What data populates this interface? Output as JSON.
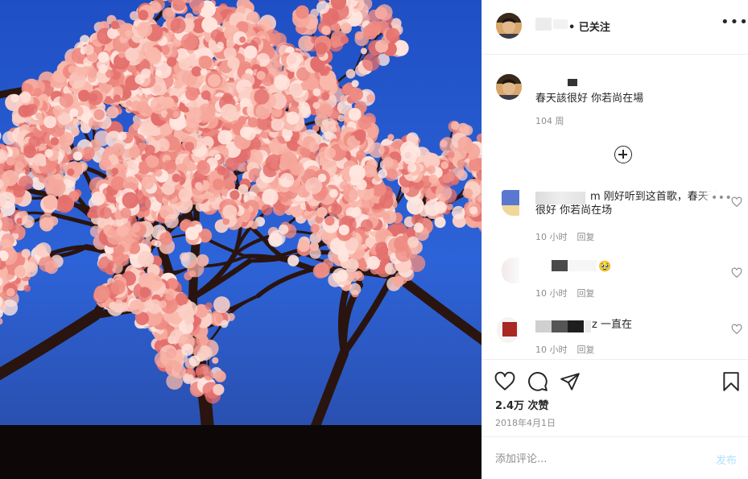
{
  "header": {
    "status_text": "• 已关注",
    "more_icon": "more-horizontal-icon"
  },
  "caption": {
    "text": "春天該很好 你若尚在場",
    "time": "104 周"
  },
  "load_more_icon": "add-circle-icon",
  "comments": [
    {
      "line1": "m 刚好听到这首歌，春天该",
      "line2": "很好 你若尚在场",
      "time": "10 小时",
      "reply": "回复",
      "more": "•••"
    },
    {
      "text": "🥹",
      "time": "10 小时",
      "reply": "回复"
    },
    {
      "text": "z 一直在",
      "time": "10 小时",
      "reply": "回复"
    }
  ],
  "actions": {
    "like_icon": "heart-icon",
    "comment_icon": "comment-icon",
    "share_icon": "paper-plane-icon",
    "save_icon": "bookmark-icon",
    "likes": "2.4万 次赞",
    "date": "2018年4月1日"
  },
  "comment_bar": {
    "placeholder": "添加评论...",
    "post_label": "发布"
  },
  "colors": {
    "text": "#262626",
    "secondary": "#8e8e8e",
    "post_disabled": "#b2dffc",
    "border": "#efefef"
  }
}
